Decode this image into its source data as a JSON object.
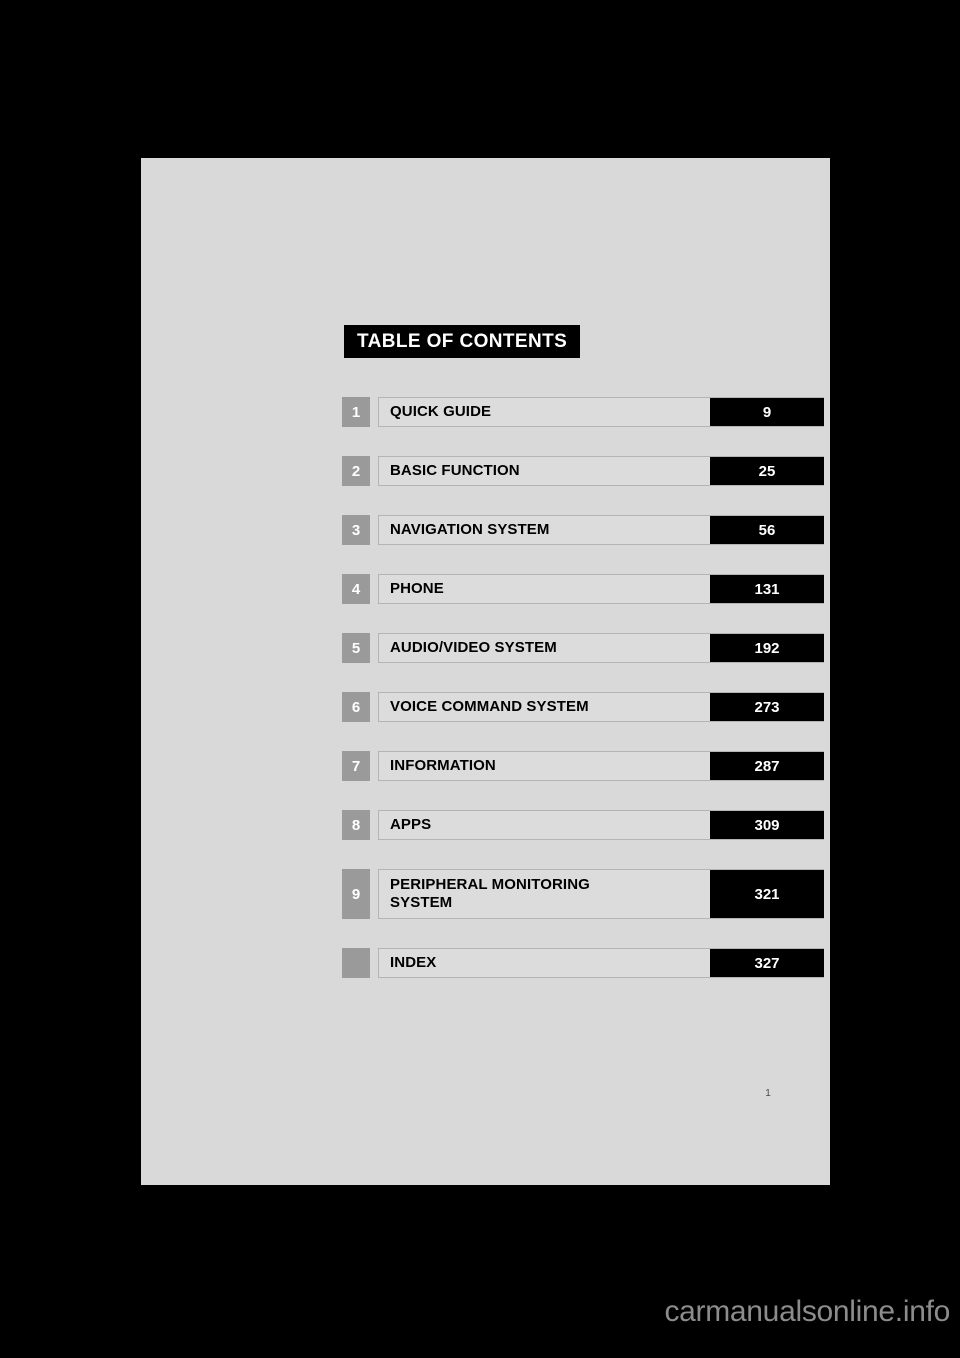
{
  "document": {
    "banner_title": "TABLE OF CONTENTS",
    "folio": "1",
    "watermark": "carmanualsonline.info",
    "colors": {
      "page_background": "#d9d9d9",
      "banner_background": "#000000",
      "chapter_chip": "#9a9a9a",
      "title_bar": "#dcdcdc",
      "page_number_box": "#000000",
      "outer_background": "#000000"
    }
  },
  "contents": [
    {
      "number": "1",
      "title_line1": "QUICK GUIDE",
      "title_line2": "",
      "page": "9"
    },
    {
      "number": "2",
      "title_line1": "BASIC FUNCTION",
      "title_line2": "",
      "page": "25"
    },
    {
      "number": "3",
      "title_line1": "NAVIGATION SYSTEM",
      "title_line2": "",
      "page": "56"
    },
    {
      "number": "4",
      "title_line1": "PHONE",
      "title_line2": "",
      "page": "131"
    },
    {
      "number": "5",
      "title_line1": "AUDIO/VIDEO SYSTEM",
      "title_line2": "",
      "page": "192"
    },
    {
      "number": "6",
      "title_line1": "VOICE COMMAND SYSTEM",
      "title_line2": "",
      "page": "273"
    },
    {
      "number": "7",
      "title_line1": "INFORMATION",
      "title_line2": "",
      "page": "287"
    },
    {
      "number": "8",
      "title_line1": "APPS",
      "title_line2": "",
      "page": "309"
    },
    {
      "number": "9",
      "title_line1": "PERIPHERAL MONITORING",
      "title_line2": "SYSTEM",
      "page": "321"
    },
    {
      "number": "",
      "title_line1": "INDEX",
      "title_line2": "",
      "page": "327"
    }
  ]
}
